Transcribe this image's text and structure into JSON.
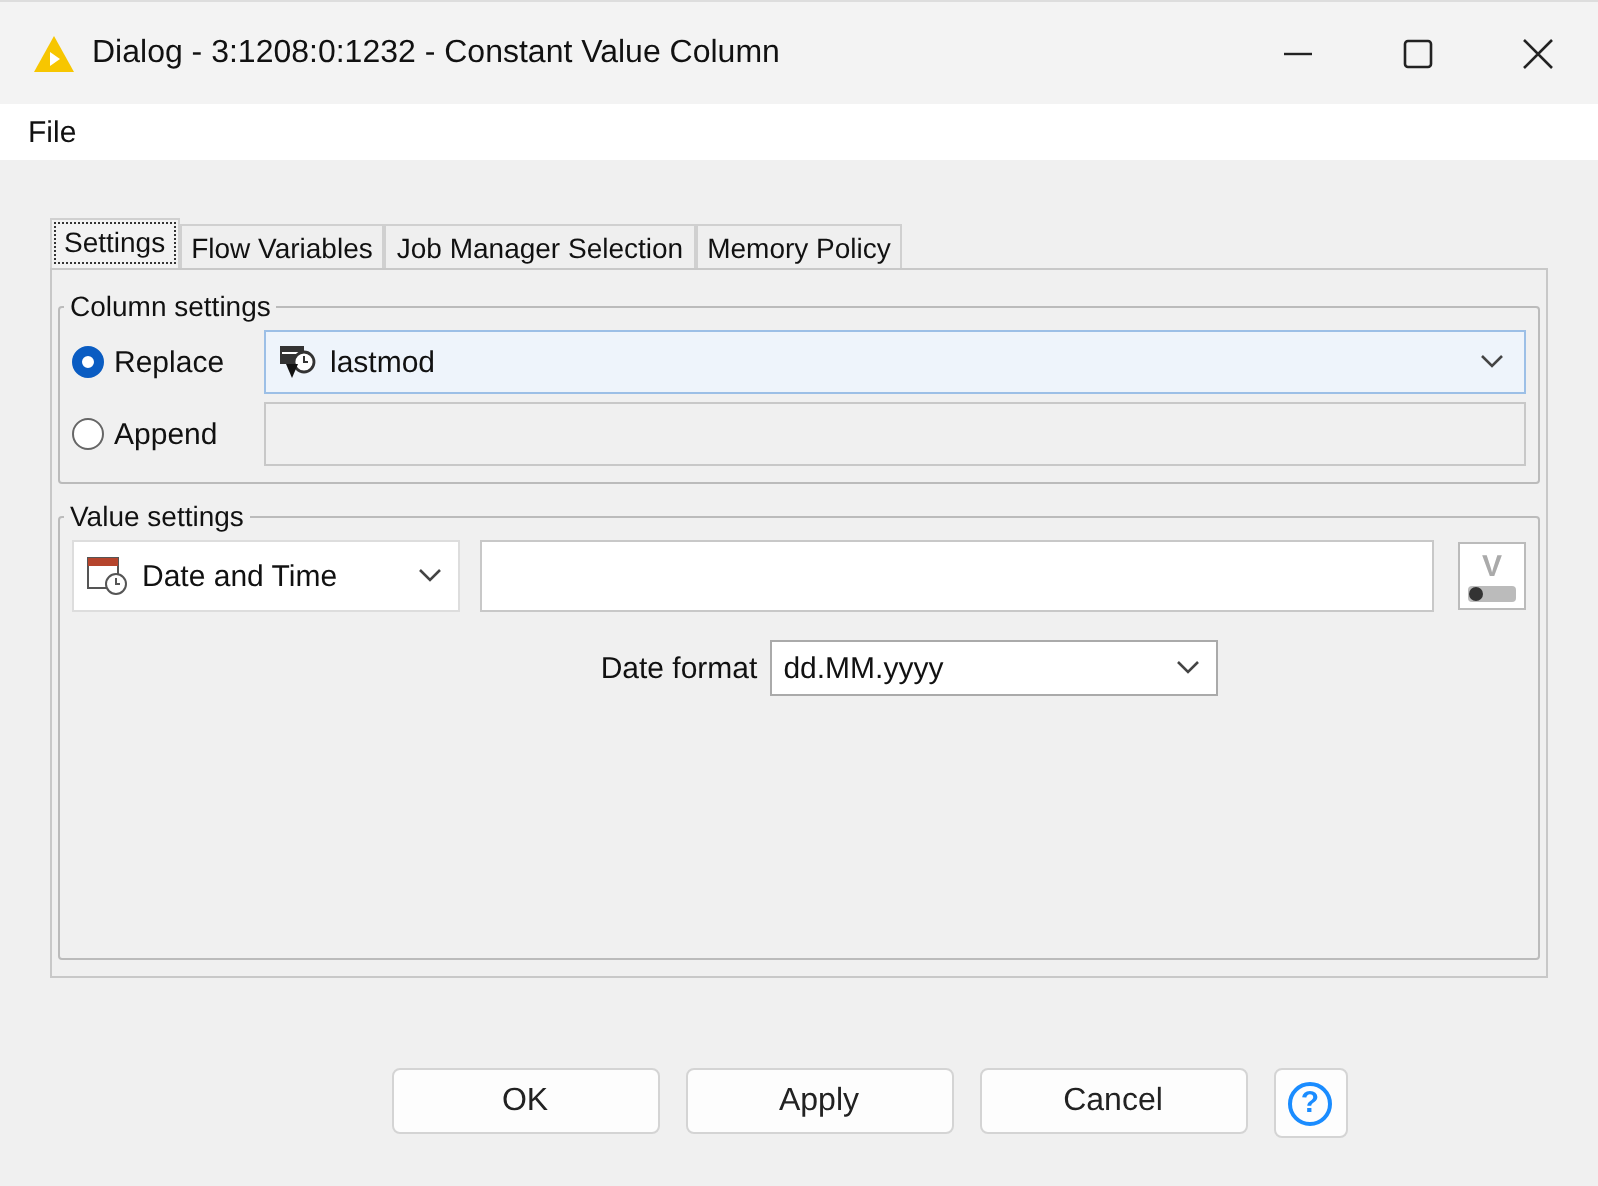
{
  "window": {
    "title": "Dialog - 3:1208:0:1232 - Constant Value Column"
  },
  "menu": [
    "File"
  ],
  "tabs": [
    {
      "label": "Settings",
      "selected": true
    },
    {
      "label": "Flow Variables",
      "selected": false
    },
    {
      "label": "Job Manager Selection",
      "selected": false
    },
    {
      "label": "Memory Policy",
      "selected": false
    }
  ],
  "column_settings": {
    "title": "Column settings",
    "options": [
      {
        "label": "Replace",
        "selected": true,
        "value": "lastmod",
        "kind": "dropdown"
      },
      {
        "label": "Append",
        "selected": false,
        "kind": "text"
      }
    ]
  },
  "value_settings": {
    "title": "Value settings",
    "type": "Date and Time",
    "flow_variable_button": {
      "label": "V"
    },
    "date_format": {
      "label": "Date format",
      "value": "dd.MM.yyyy"
    }
  },
  "buttons": [
    "OK",
    "Apply",
    "Cancel"
  ],
  "help_button": {
    "label": "?"
  }
}
